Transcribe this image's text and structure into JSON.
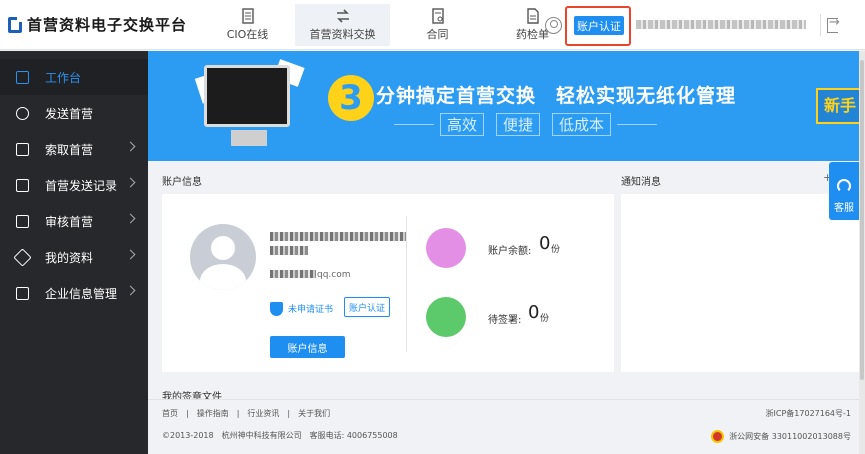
{
  "header": {
    "logo_text": "首营资料电子交换平台",
    "nav": [
      {
        "label": "CIO在线",
        "icon": "document-icon",
        "active": false
      },
      {
        "label": "首营资料交换",
        "icon": "swap-icon",
        "active": true
      },
      {
        "label": "合同",
        "icon": "contract-icon",
        "active": false
      },
      {
        "label": "药检单",
        "icon": "report-icon",
        "active": false
      }
    ],
    "verify_label": "账户认证"
  },
  "sidebar": {
    "items": [
      {
        "label": "工作台",
        "active": true,
        "has_chevron": false
      },
      {
        "label": "发送首营",
        "active": false,
        "has_chevron": false
      },
      {
        "label": "索取首营",
        "active": false,
        "has_chevron": true
      },
      {
        "label": "首营发送记录",
        "active": false,
        "has_chevron": true
      },
      {
        "label": "审核首营",
        "active": false,
        "has_chevron": true
      },
      {
        "label": "我的资料",
        "active": false,
        "has_chevron": true
      },
      {
        "label": "企业信息管理",
        "active": false,
        "has_chevron": true
      }
    ]
  },
  "banner": {
    "number": "3",
    "title": "分钟搞定首营交换　轻松实现无纸化管理",
    "tags": [
      "高效",
      "便捷",
      "低成本"
    ],
    "right_text": "新手"
  },
  "account": {
    "section_title": "账户信息",
    "email_suffix": "qq.com",
    "status_text": "未申请证书",
    "verify_label": "账户认证",
    "info_button": "账户信息",
    "balance_label": "账户余额:",
    "balance_value": "0",
    "balance_unit": "份",
    "pending_label": "待签署:",
    "pending_value": "0",
    "pending_unit": "份"
  },
  "notice": {
    "section_title": "通知消息",
    "more": "+"
  },
  "signed": {
    "section_title": "我的签章文件"
  },
  "kefu": {
    "label": "客服"
  },
  "footer": {
    "links": "首页　|　操作指南　|　行业资讯　|　关于我们",
    "copyright": "©2013-2018　杭州神中科技有限公司　客服电话: 4006755008",
    "icp": "浙ICP备17027164号-1",
    "police": "浙公网安备 33011002013088号"
  },
  "colors": {
    "accent": "#1e8ef0",
    "banner": "#2c9cf2",
    "sidebar": "#27282c",
    "highlight": "#e8452d"
  }
}
